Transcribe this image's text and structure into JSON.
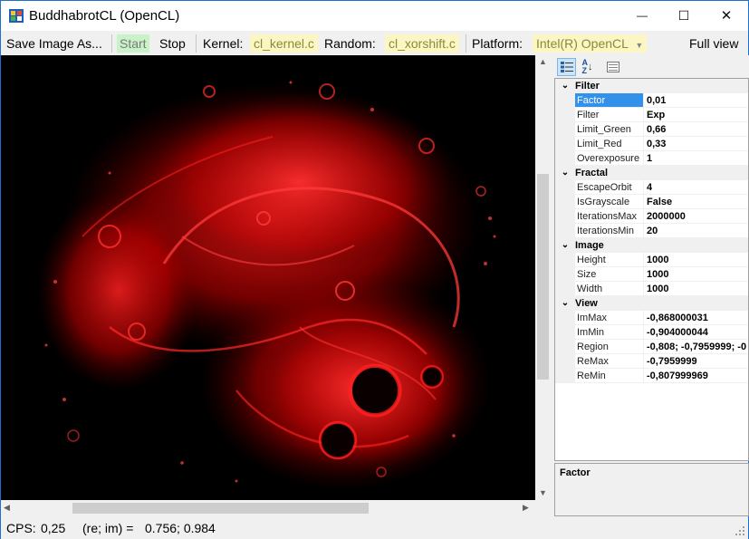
{
  "window": {
    "title": "BuddhabrotCL (OpenCL)",
    "minimize_glyph": "—",
    "maximize_glyph": "☐",
    "close_glyph": "✕"
  },
  "toolbar": {
    "save_label": "Save Image As...",
    "start_label": "Start",
    "stop_label": "Stop",
    "kernel_label": "Kernel:",
    "kernel_value": "cl_kernel.c",
    "random_label": "Random:",
    "random_value": "cl_xorshift.c",
    "platform_label": "Platform:",
    "platform_value": "Intel(R) OpenCL",
    "fullview_label": "Full view"
  },
  "property_grid": {
    "categories": [
      {
        "name": "Filter",
        "items": [
          {
            "name": "Factor",
            "value": "0,01"
          },
          {
            "name": "Filter",
            "value": "Exp"
          },
          {
            "name": "Limit_Green",
            "value": "0,66"
          },
          {
            "name": "Limit_Red",
            "value": "0,33"
          },
          {
            "name": "Overexposure",
            "value": "1"
          }
        ]
      },
      {
        "name": "Fractal",
        "items": [
          {
            "name": "EscapeOrbit",
            "value": "4"
          },
          {
            "name": "IsGrayscale",
            "value": "False"
          },
          {
            "name": "IterationsMax",
            "value": "2000000"
          },
          {
            "name": "IterationsMin",
            "value": "20"
          }
        ]
      },
      {
        "name": "Image",
        "items": [
          {
            "name": "Height",
            "value": "1000"
          },
          {
            "name": "Size",
            "value": "1000"
          },
          {
            "name": "Width",
            "value": "1000"
          }
        ]
      },
      {
        "name": "View",
        "items": [
          {
            "name": "ImMax",
            "value": "-0,868000031"
          },
          {
            "name": "ImMin",
            "value": "-0,904000044"
          },
          {
            "name": "Region",
            "value": "-0,808; -0,7959999; -0"
          },
          {
            "name": "ReMax",
            "value": "-0,7959999"
          },
          {
            "name": "ReMin",
            "value": "-0,807999969"
          }
        ]
      }
    ],
    "description_title": "Factor"
  },
  "status": {
    "cps_label": "CPS:",
    "cps_value": "0,25",
    "coord_label": "(re; im) =",
    "coord_value": "0.756; 0.984"
  },
  "colors": {
    "fractal": "#ff1010",
    "selection": "#3391ea",
    "start_bg": "#c9f2c9",
    "kernel_bg": "#fcf6c4"
  }
}
